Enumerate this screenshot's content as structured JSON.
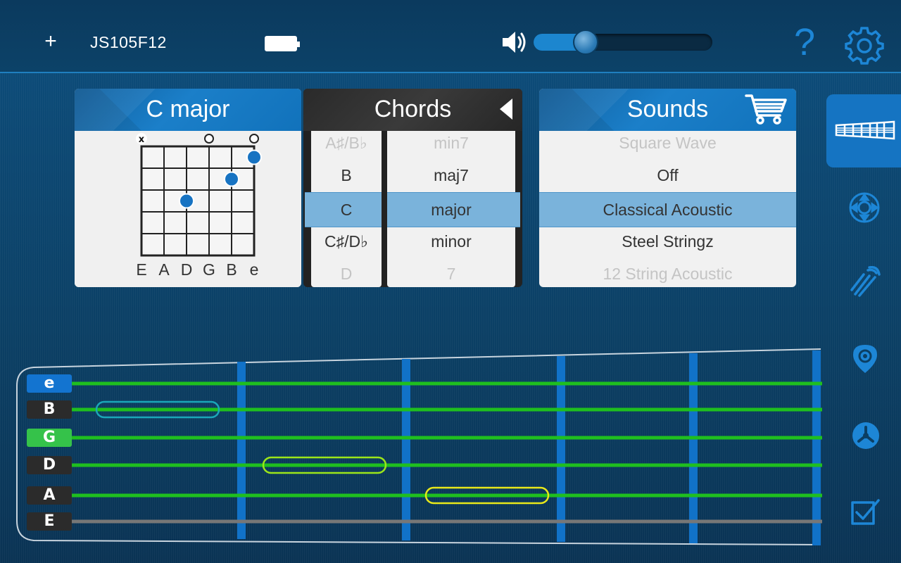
{
  "topbar": {
    "add_label": "+",
    "device_name": "JS105F12",
    "battery_icon": "battery-full-icon",
    "volume_level": 0.22,
    "help_label": "?",
    "settings_icon": "gear-icon"
  },
  "chord_diagram": {
    "title": "C major",
    "string_markers": [
      "x",
      "",
      "",
      "o",
      "",
      "o"
    ],
    "string_names": [
      "E",
      "A",
      "D",
      "G",
      "B",
      "e"
    ],
    "fingers": [
      {
        "string": 5,
        "fret": 1
      },
      {
        "string": 4,
        "fret": 2
      },
      {
        "string": 2,
        "fret": 3
      }
    ]
  },
  "chords": {
    "title": "Chords",
    "roots": [
      "A♯/B♭",
      "B",
      "C",
      "C♯/D♭",
      "D"
    ],
    "types": [
      "min7",
      "maj7",
      "major",
      "minor",
      "7"
    ],
    "selected_root": "C",
    "selected_type": "major"
  },
  "sounds": {
    "title": "Sounds",
    "items": [
      "Square Wave",
      "Off",
      "Classical Acoustic",
      "Steel Stringz",
      "12 String Acoustic"
    ],
    "selected": "Classical Acoustic"
  },
  "sidebar": {
    "items": [
      "guitar-neck-icon",
      "dpad-icon",
      "strum-hand-icon",
      "pick-icon",
      "fan-icon",
      "checkbox-icon"
    ],
    "active": "guitar-neck-icon"
  },
  "fretboard": {
    "strings": [
      {
        "label": "e",
        "label_color": "#1374d0",
        "line_color": "#1fbf1f"
      },
      {
        "label": "B",
        "label_color": "#2b2b2b",
        "line_color": "#1fbf1f"
      },
      {
        "label": "G",
        "label_color": "#35c24a",
        "line_color": "#1fbf1f"
      },
      {
        "label": "D",
        "label_color": "#2b2b2b",
        "line_color": "#1fbf1f"
      },
      {
        "label": "A",
        "label_color": "#2b2b2b",
        "line_color": "#1fbf1f"
      },
      {
        "label": "E",
        "label_color": "#2b2b2b",
        "line_color": "#777777"
      }
    ],
    "notes": [
      {
        "string": "B",
        "fret": 1,
        "color": "#1aa7b8"
      },
      {
        "string": "D",
        "fret": 2,
        "color": "#9be51a"
      },
      {
        "string": "A",
        "fret": 3,
        "color": "#e8e81a"
      }
    ],
    "fret_color": "#1172c8"
  }
}
